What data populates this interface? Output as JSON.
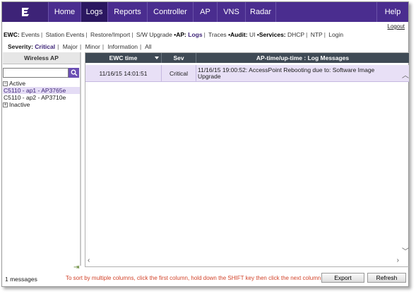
{
  "nav": {
    "logo_icon": "extreme-logo-icon",
    "items": [
      {
        "label": "Home",
        "active": false
      },
      {
        "label": "Logs",
        "active": true
      },
      {
        "label": "Reports",
        "active": false
      },
      {
        "label": "Controller",
        "active": false
      },
      {
        "label": "AP",
        "active": false
      },
      {
        "label": "VNS",
        "active": false
      },
      {
        "label": "Radar",
        "active": false
      }
    ],
    "help_label": "Help",
    "logout_label": "Logout"
  },
  "subnav": {
    "ewc_label": "EWC:",
    "ewc_links": [
      "Events",
      "Station Events",
      "Restore/Import",
      "S/W Upgrade"
    ],
    "ap_label": "•AP:",
    "ap_links": [
      "Logs",
      "Traces"
    ],
    "audit_label": "•Audit:",
    "audit_links": [
      "UI"
    ],
    "services_label": "•Services:",
    "services_links": [
      "DHCP",
      "NTP",
      "Login"
    ]
  },
  "severity": {
    "label": "Severity:",
    "options": [
      "Critical",
      "Major",
      "Minor",
      "Information",
      "All"
    ],
    "selected": "Critical"
  },
  "left_panel": {
    "header": "Wireless AP",
    "search_placeholder": "",
    "search_icon": "search-icon",
    "groups": [
      {
        "label": "Active",
        "expanded": true,
        "items": [
          "C5110 - ap1 - AP3765e",
          "C5110 - ap2 - AP3710e"
        ]
      },
      {
        "label": "Inactive",
        "expanded": false,
        "items": []
      }
    ]
  },
  "table": {
    "columns": [
      "EWC time",
      "Sev",
      "AP-time/up-time  : Log Messages"
    ],
    "rows": [
      {
        "ewc_time": "11/16/15 14:01:51",
        "sev": "Critical",
        "message": "11/16/15 19:00:52: AccessPoint Rebooting due to: Software Image Upgrade"
      }
    ]
  },
  "footer": {
    "message_count": "1 messages",
    "hint": "To sort by multiple columns, click the first column, hold down the SHIFT key then click the next column.",
    "export_label": "Export",
    "refresh_label": "Refresh"
  },
  "colors": {
    "nav_bg": "#4a2d8f",
    "nav_active": "#2b1760",
    "accent": "#3d2377",
    "hint": "#d2432a",
    "row_highlight": "#e8e0f6",
    "table_header": "#3f4a55"
  }
}
